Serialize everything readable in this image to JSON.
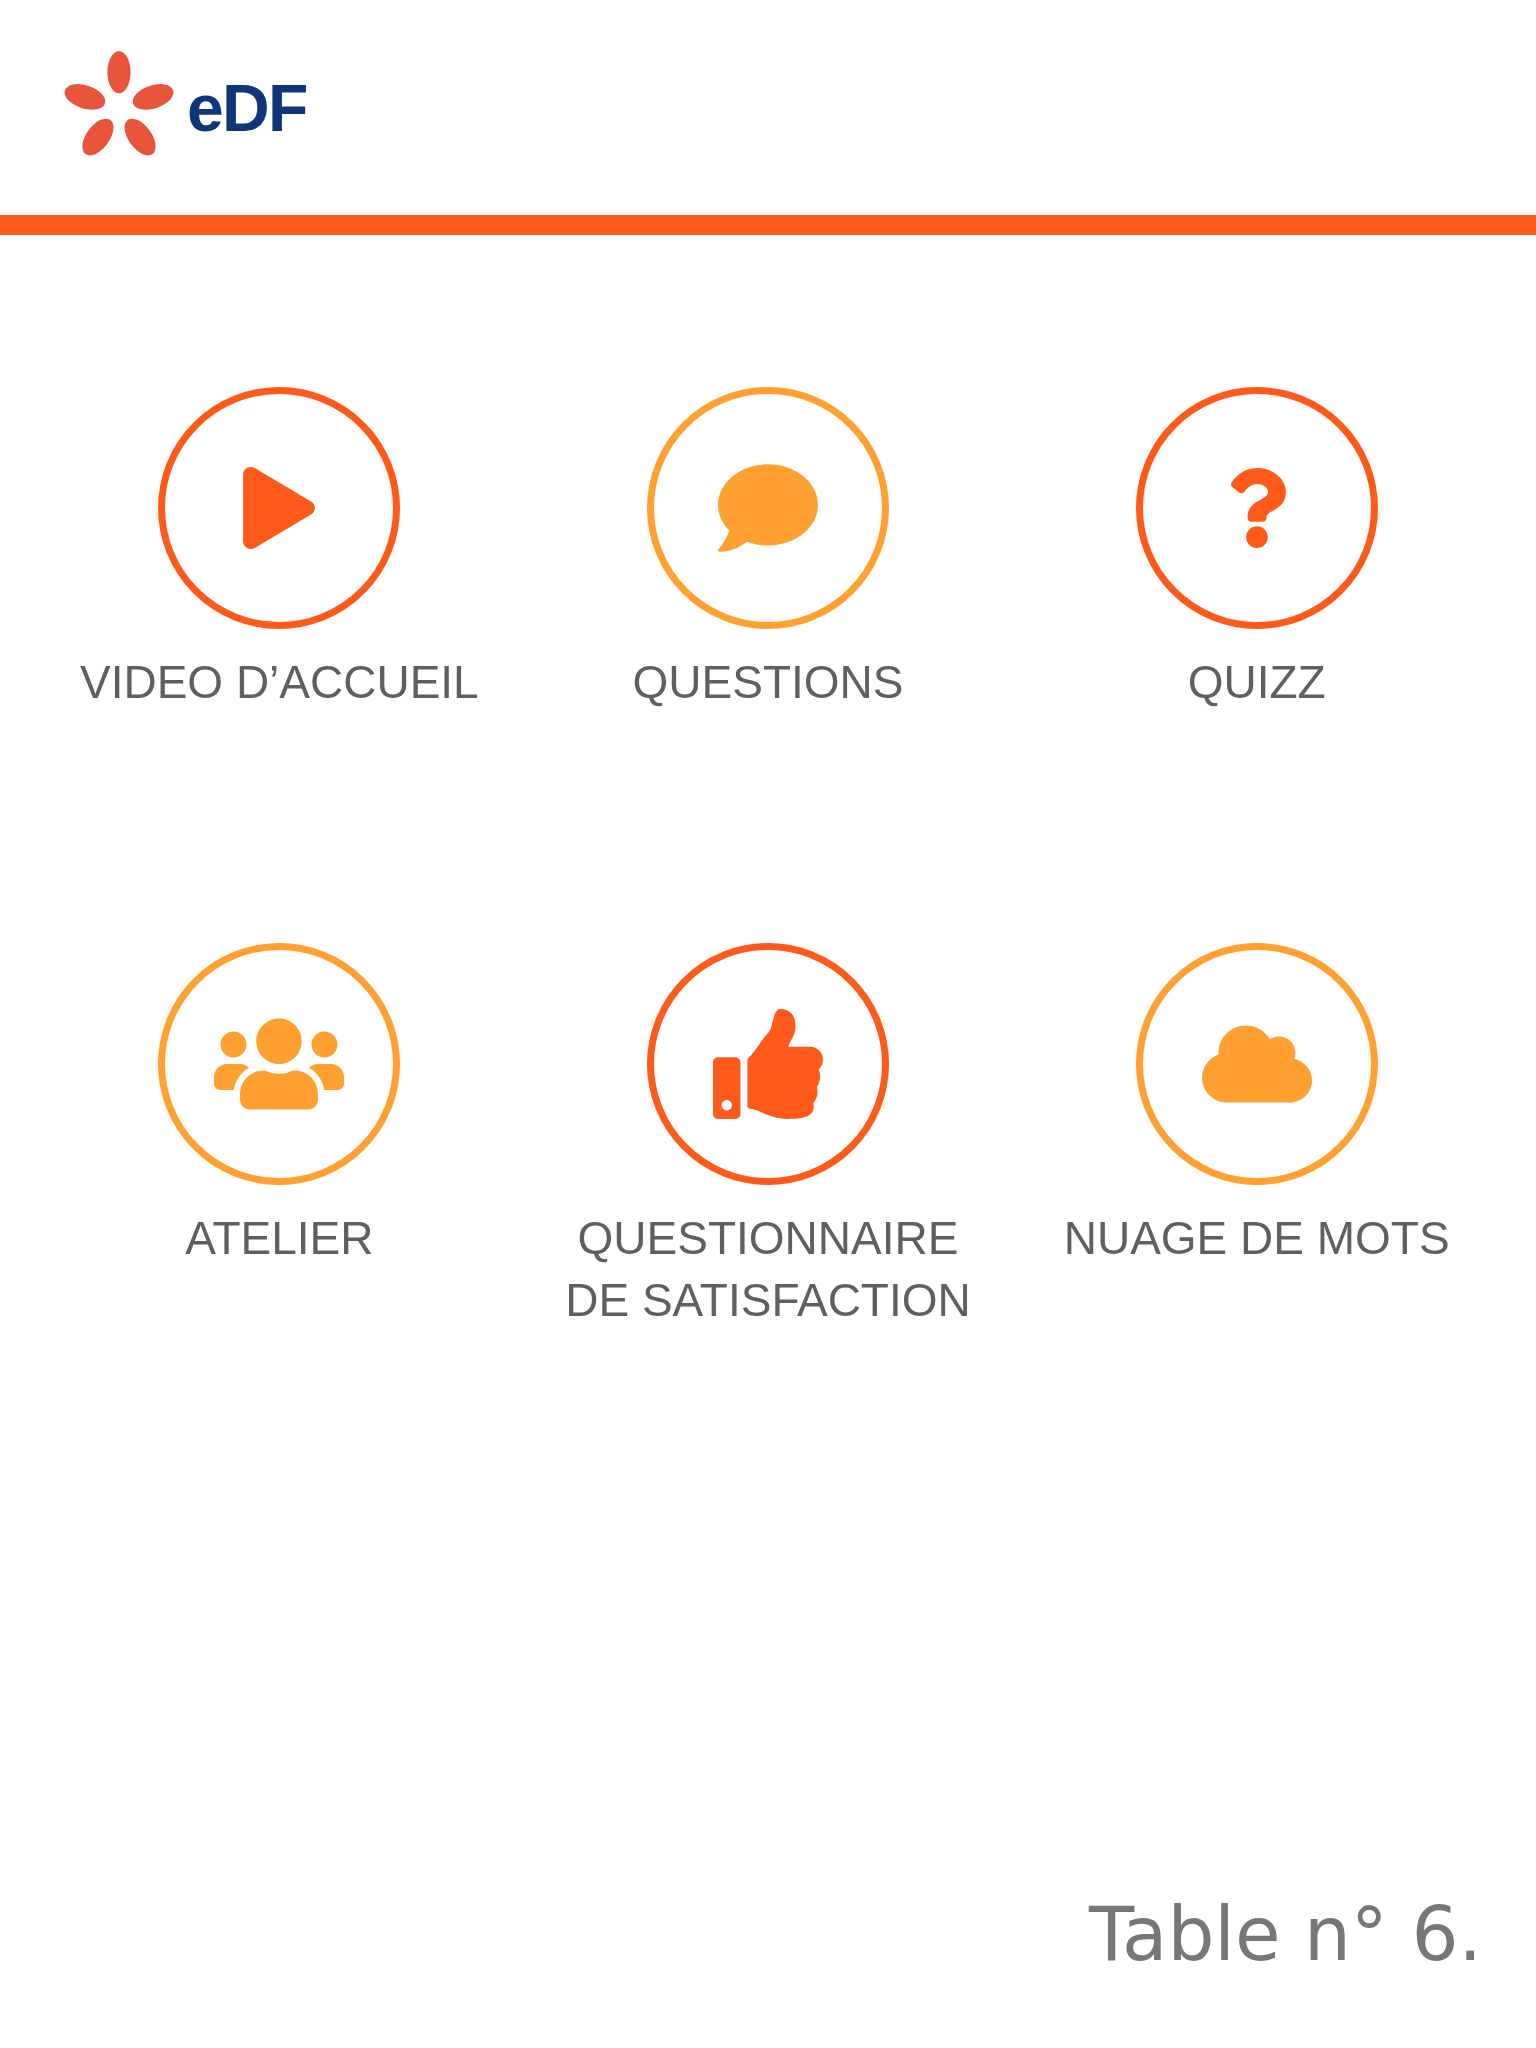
{
  "header": {
    "logo_text": "eDF"
  },
  "menu": [
    {
      "label": "VIDEO D’ACCUEIL",
      "kind": "play",
      "color": "#ff5a1a"
    },
    {
      "label": "QUESTIONS",
      "kind": "speech",
      "color": "#ffa030"
    },
    {
      "label": "QUIZZ",
      "kind": "question",
      "color": "#ff5a1a"
    },
    {
      "label": "ATELIER",
      "kind": "group",
      "color": "#ffa030"
    },
    {
      "label": "QUESTIONNAIRE DE SATISFACTION",
      "kind": "thumb",
      "color": "#ff5a1a"
    },
    {
      "label": "NUAGE DE MOTS",
      "kind": "cloud",
      "color": "#ffa030"
    }
  ],
  "footer": {
    "table_label": "Table n° 6."
  }
}
